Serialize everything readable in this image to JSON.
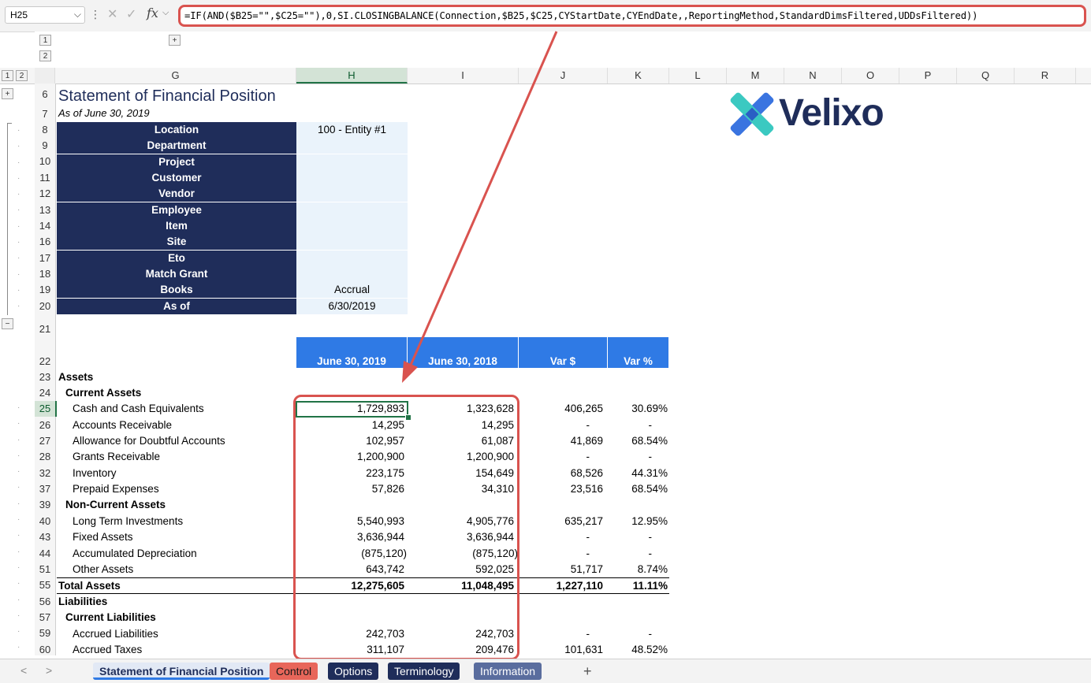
{
  "formula_bar": {
    "name_box": "H25",
    "fx": "fx",
    "formula": "=IF(AND($B25=\"\",$C25=\"\"),0,SI.CLOSINGBALANCE(Connection,$B25,$C25,CYStartDate,CYEndDate,,ReportingMethod,StandardDimsFiltered,UDDsFiltered))"
  },
  "outline": {
    "col_levels": [
      "1",
      "2"
    ],
    "row_levels": [
      "1",
      "2"
    ],
    "expand": "+",
    "collapse": "−"
  },
  "columns": [
    "G",
    "H",
    "I",
    "J",
    "K",
    "L",
    "M",
    "N",
    "O",
    "P",
    "Q",
    "R"
  ],
  "rows": [
    "6",
    "7",
    "8",
    "9",
    "10",
    "11",
    "12",
    "13",
    "14",
    "16",
    "17",
    "18",
    "19",
    "20",
    "21",
    "22",
    "23",
    "24",
    "25",
    "26",
    "27",
    "28",
    "32",
    "37",
    "39",
    "40",
    "43",
    "44",
    "51",
    "55",
    "56",
    "57",
    "59",
    "60"
  ],
  "report": {
    "title": "Statement of Financial Position",
    "subtitle": "As of June 30, 2019",
    "logo_text": "Velixo",
    "filters": [
      {
        "label": "Location",
        "value": "100 - Entity #1"
      },
      {
        "label": "Department",
        "value": ""
      },
      {
        "label": "Project",
        "value": ""
      },
      {
        "label": "Customer",
        "value": ""
      },
      {
        "label": "Vendor",
        "value": ""
      },
      {
        "label": "Employee",
        "value": ""
      },
      {
        "label": "Item",
        "value": ""
      },
      {
        "label": "Site",
        "value": ""
      },
      {
        "label": "Eto",
        "value": ""
      },
      {
        "label": "Match Grant",
        "value": ""
      },
      {
        "label": "Books",
        "value": "Accrual"
      },
      {
        "label": "As of",
        "value": "6/30/2019"
      }
    ],
    "table_headers": [
      "June 30, 2019",
      "June 30, 2018",
      "Var $",
      "Var %"
    ],
    "lines": [
      {
        "label": "Assets",
        "h": "",
        "i": "",
        "j": "",
        "k": ""
      },
      {
        "label": "Current Assets",
        "h": "",
        "i": "",
        "j": "",
        "k": ""
      },
      {
        "label": "Cash and Cash Equivalents",
        "h": "1,729,893",
        "i": "1,323,628",
        "j": "406,265",
        "k": "30.69%"
      },
      {
        "label": "Accounts Receivable",
        "h": "14,295",
        "i": "14,295",
        "j": "-",
        "k": "-"
      },
      {
        "label": "Allowance for Doubtful Accounts",
        "h": "102,957",
        "i": "61,087",
        "j": "41,869",
        "k": "68.54%"
      },
      {
        "label": "Grants Receivable",
        "h": "1,200,900",
        "i": "1,200,900",
        "j": "-",
        "k": "-"
      },
      {
        "label": "Inventory",
        "h": "223,175",
        "i": "154,649",
        "j": "68,526",
        "k": "44.31%"
      },
      {
        "label": "Prepaid Expenses",
        "h": "57,826",
        "i": "34,310",
        "j": "23,516",
        "k": "68.54%"
      },
      {
        "label": "Non-Current Assets",
        "h": "",
        "i": "",
        "j": "",
        "k": ""
      },
      {
        "label": "Long Term Investments",
        "h": "5,540,993",
        "i": "4,905,776",
        "j": "635,217",
        "k": "12.95%"
      },
      {
        "label": "Fixed Assets",
        "h": "3,636,944",
        "i": "3,636,944",
        "j": "-",
        "k": "-"
      },
      {
        "label": "Accumulated Depreciation",
        "h": "(875,120)",
        "i": "(875,120)",
        "j": "-",
        "k": "-"
      },
      {
        "label": "Other Assets",
        "h": "643,742",
        "i": "592,025",
        "j": "51,717",
        "k": "8.74%"
      },
      {
        "label": "Total Assets",
        "h": "12,275,605",
        "i": "11,048,495",
        "j": "1,227,110",
        "k": "11.11%"
      },
      {
        "label": "Liabilities",
        "h": "",
        "i": "",
        "j": "",
        "k": ""
      },
      {
        "label": "Current Liabilities",
        "h": "",
        "i": "",
        "j": "",
        "k": ""
      },
      {
        "label": "Accrued Liabilities",
        "h": "242,703",
        "i": "242,703",
        "j": "-",
        "k": "-"
      },
      {
        "label": "Accrued Taxes",
        "h": "311,107",
        "i": "209,476",
        "j": "101,631",
        "k": "48.52%"
      }
    ]
  },
  "tabs": {
    "prev": "<",
    "next": ">",
    "items": [
      "Statement of Financial Position",
      "Control",
      "Options",
      "Terminology",
      "Information"
    ],
    "add": "+"
  },
  "colors": {
    "navy": "#1f2d5a",
    "header_blue": "#2f7ae5",
    "highlight_red": "#d9534f",
    "selected_green": "#217346"
  }
}
